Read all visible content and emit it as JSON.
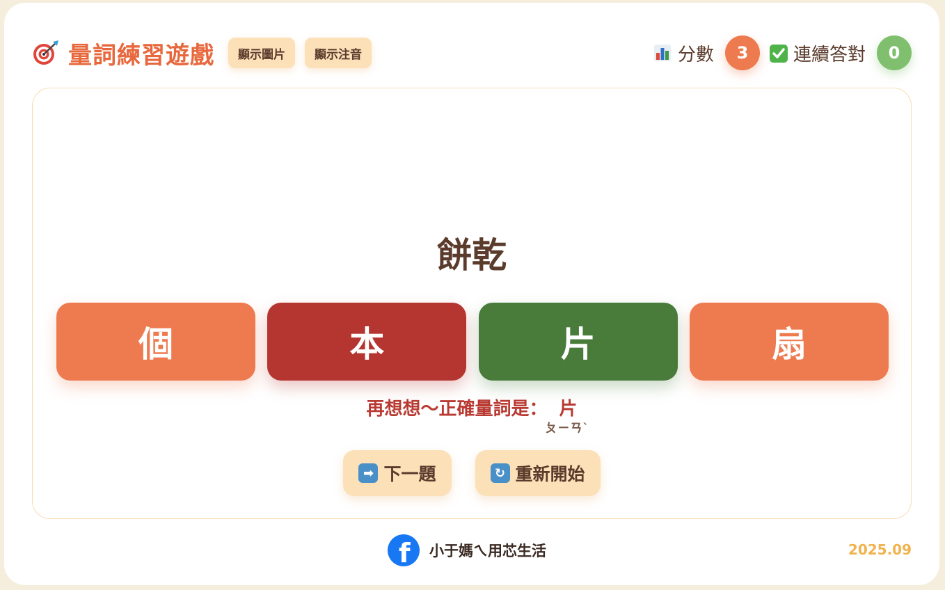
{
  "header": {
    "title": "量詞練習遊戲",
    "buttons": [
      {
        "label": "顯示圖片"
      },
      {
        "label": "顯示注音"
      }
    ],
    "score_label": "分數",
    "score_value": "3",
    "streak_label": "連續答對",
    "streak_value": "0",
    "icons": {
      "title": "target-icon",
      "score": "bar-chart-icon",
      "streak": "check-box-icon"
    }
  },
  "game": {
    "word": "餅乾",
    "options": [
      {
        "label": "個",
        "state": "normal"
      },
      {
        "label": "本",
        "state": "wrong"
      },
      {
        "label": "片",
        "state": "correct"
      },
      {
        "label": "扇",
        "state": "normal"
      }
    ],
    "feedback_text": "再想想～正確量詞是：",
    "correct_answer": "片",
    "correct_zhuyin": "ㄆㄧㄢˋ",
    "next_label": "下一題",
    "restart_label": "重新開始",
    "next_icon_glyph": "➡",
    "restart_icon_glyph": "↻"
  },
  "footer": {
    "facebook_name": "小于媽ㄟ用芯生活",
    "date": "2025.09"
  },
  "colors": {
    "accent": "#e8683d",
    "option": "#ee7b50",
    "wrong": "#b53630",
    "correct": "#497b3b",
    "pill": "#fbe0b8",
    "score_badge": "#ee7a4f",
    "streak_badge": "#7fbf6e",
    "facebook": "#1877f2",
    "date": "#f0b34e"
  }
}
